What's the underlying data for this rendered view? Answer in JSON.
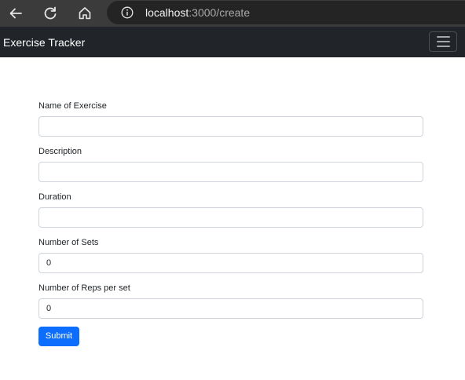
{
  "browser": {
    "url_host": "localhost",
    "url_rest": ":3000/create"
  },
  "navbar": {
    "brand": "Exercise Tracker"
  },
  "form": {
    "fields": [
      {
        "label": "Name of Exercise",
        "value": ""
      },
      {
        "label": "Description",
        "value": ""
      },
      {
        "label": "Duration",
        "value": ""
      },
      {
        "label": "Number of Sets",
        "value": "0"
      },
      {
        "label": "Number of Reps per set",
        "value": "0"
      }
    ],
    "submit_label": "Submit"
  },
  "colors": {
    "browser_toolbar": "#3b3b3b",
    "address_bar": "#242424",
    "navbar": "#212529",
    "primary": "#0d6efd",
    "input_border": "#ced4da"
  },
  "icons": [
    "back-arrow-icon",
    "reload-icon",
    "home-icon",
    "info-icon",
    "hamburger-menu-icon"
  ]
}
